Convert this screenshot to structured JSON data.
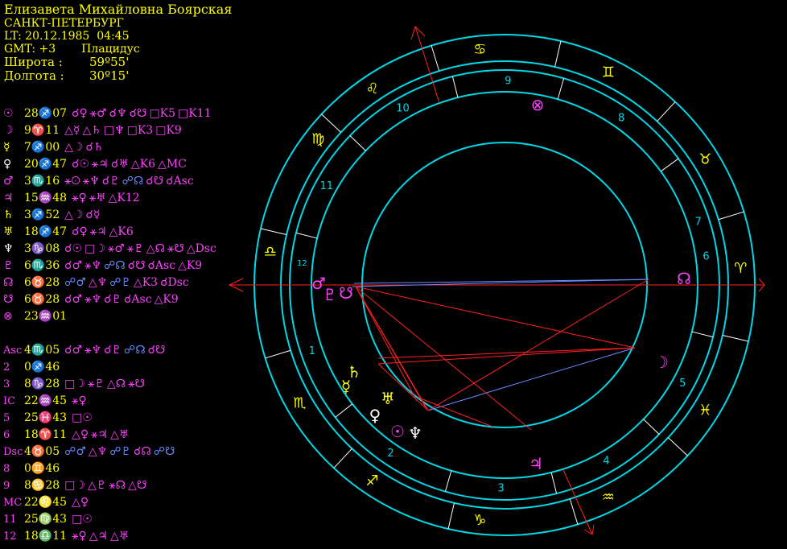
{
  "header": {
    "name": "Елизавета Михайловна Боярская",
    "city": "САНКТ-ПЕТЕРБУРГ",
    "local_time": "LT: 20.12.1985  04:45",
    "gmt": "GMT: +3",
    "house_system": "Плацидус",
    "latitude_label": "Широта :",
    "latitude_value": "59º55'",
    "longitude_label": "Долгота :",
    "longitude_value": "30º15'"
  },
  "colors": {
    "yellow": "#ffff00",
    "magenta": "#ff40ff",
    "cyan": "#00d8e8",
    "blue": "#6a8cff",
    "red": "#ff2020",
    "white": "#ffffff",
    "background": "#000000"
  },
  "planets": [
    {
      "glyph": "☉",
      "color": "#ff40ff",
      "pos": "28♐07",
      "aspects": [
        {
          "t": "☌♀",
          "c": "#ff40ff"
        },
        {
          "t": "⚹♂",
          "c": "#ff40ff"
        },
        {
          "t": "☌♆",
          "c": "#ff40ff"
        },
        {
          "t": "☌☋",
          "c": "#ff40ff"
        },
        {
          "t": "□K5",
          "c": "#ff40ff"
        },
        {
          "t": "□K11",
          "c": "#ff40ff"
        }
      ]
    },
    {
      "glyph": "☽",
      "color": "#ff40ff",
      "pos": "9♈11",
      "aspects": [
        {
          "t": "△☿",
          "c": "#ff40ff"
        },
        {
          "t": "△♄",
          "c": "#ff40ff"
        },
        {
          "t": "□♆",
          "c": "#ff40ff"
        },
        {
          "t": "□K3",
          "c": "#ff40ff"
        },
        {
          "t": "□K9",
          "c": "#ff40ff"
        }
      ]
    },
    {
      "glyph": "☿",
      "color": "#ffff00",
      "pos": "7♐00",
      "aspects": [
        {
          "t": "△☽",
          "c": "#ff40ff"
        },
        {
          "t": "☌♄",
          "c": "#ff40ff"
        }
      ]
    },
    {
      "glyph": "♀",
      "color": "#ffffff",
      "pos": "20♐47",
      "aspects": [
        {
          "t": "☌☉",
          "c": "#ff40ff"
        },
        {
          "t": "⚹♃",
          "c": "#ff40ff"
        },
        {
          "t": "☌♅",
          "c": "#ff40ff"
        },
        {
          "t": "△K6",
          "c": "#ff40ff"
        },
        {
          "t": "△MC",
          "c": "#ff40ff"
        }
      ]
    },
    {
      "glyph": "♂",
      "color": "#ff40ff",
      "pos": "3♏16",
      "aspects": [
        {
          "t": "⚹☉",
          "c": "#ff40ff"
        },
        {
          "t": "⚹♆",
          "c": "#ff40ff"
        },
        {
          "t": "☌♇",
          "c": "#ff40ff"
        },
        {
          "t": "☍☊",
          "c": "#6a8cff"
        },
        {
          "t": "☌☋",
          "c": "#ff40ff"
        },
        {
          "t": "☌Asc",
          "c": "#ff40ff"
        }
      ]
    },
    {
      "glyph": "♃",
      "color": "#ff40ff",
      "pos": "15♒48",
      "aspects": [
        {
          "t": "⚹♀",
          "c": "#ff40ff"
        },
        {
          "t": "⚹♅",
          "c": "#ff40ff"
        },
        {
          "t": "△K12",
          "c": "#ff40ff"
        }
      ]
    },
    {
      "glyph": "♄",
      "color": "#ffff00",
      "pos": "3♐52",
      "aspects": [
        {
          "t": "△☽",
          "c": "#ff40ff"
        },
        {
          "t": "☌☿",
          "c": "#ff40ff"
        }
      ]
    },
    {
      "glyph": "♅",
      "color": "#ffff00",
      "pos": "18♐47",
      "aspects": [
        {
          "t": "☌♀",
          "c": "#ff40ff"
        },
        {
          "t": "⚹♃",
          "c": "#ff40ff"
        },
        {
          "t": "△K6",
          "c": "#ff40ff"
        }
      ]
    },
    {
      "glyph": "♆",
      "color": "#ffffff",
      "pos": "3♑08",
      "aspects": [
        {
          "t": "☌☉",
          "c": "#ff40ff"
        },
        {
          "t": "□☽",
          "c": "#ff40ff"
        },
        {
          "t": "⚹♂",
          "c": "#ff40ff"
        },
        {
          "t": "⚹♇",
          "c": "#ff40ff"
        },
        {
          "t": "△☊",
          "c": "#ff40ff"
        },
        {
          "t": "⚹☋",
          "c": "#ff40ff"
        },
        {
          "t": "△Dsc",
          "c": "#ff40ff"
        }
      ]
    },
    {
      "glyph": "♇",
      "color": "#ff40ff",
      "pos": "6♏36",
      "aspects": [
        {
          "t": "☌♂",
          "c": "#ff40ff"
        },
        {
          "t": "⚹♆",
          "c": "#ff40ff"
        },
        {
          "t": "☍☊",
          "c": "#6a8cff"
        },
        {
          "t": "☌☋",
          "c": "#ff40ff"
        },
        {
          "t": "☌Asc",
          "c": "#ff40ff"
        },
        {
          "t": "△K9",
          "c": "#ff40ff"
        }
      ]
    },
    {
      "glyph": "☊",
      "color": "#ff40ff",
      "pos": "6♉28",
      "aspects": [
        {
          "t": "☍♂",
          "c": "#6a8cff"
        },
        {
          "t": "△♆",
          "c": "#ff40ff"
        },
        {
          "t": "☍♇",
          "c": "#6a8cff"
        },
        {
          "t": "△K3",
          "c": "#ff40ff"
        },
        {
          "t": "☌Dsc",
          "c": "#ff40ff"
        }
      ]
    },
    {
      "glyph": "☋",
      "color": "#ff40ff",
      "pos": "6♉28",
      "aspects": [
        {
          "t": "☌♂",
          "c": "#ff40ff"
        },
        {
          "t": "⚹♆",
          "c": "#ff40ff"
        },
        {
          "t": "☌♇",
          "c": "#ff40ff"
        },
        {
          "t": "☌Asc",
          "c": "#ff40ff"
        },
        {
          "t": "△K9",
          "c": "#ff40ff"
        }
      ]
    },
    {
      "glyph": "⊗",
      "color": "#ff40ff",
      "pos": "23♒01",
      "aspects": []
    }
  ],
  "houses": [
    {
      "label": "Asc",
      "pos": "4♏05",
      "aspects": [
        {
          "t": "☌♂",
          "c": "#ff40ff"
        },
        {
          "t": "⚹♆",
          "c": "#ff40ff"
        },
        {
          "t": "☌♇",
          "c": "#ff40ff"
        },
        {
          "t": "☍☊",
          "c": "#6a8cff"
        },
        {
          "t": "☌☋",
          "c": "#ff40ff"
        }
      ]
    },
    {
      "label": "2",
      "pos": "0♐46",
      "aspects": []
    },
    {
      "label": "3",
      "pos": "8♑28",
      "aspects": [
        {
          "t": "□☽",
          "c": "#ff40ff"
        },
        {
          "t": "⚹♇",
          "c": "#ff40ff"
        },
        {
          "t": "△☊",
          "c": "#ff40ff"
        },
        {
          "t": "⚹☋",
          "c": "#ff40ff"
        }
      ]
    },
    {
      "label": "IC",
      "pos": "22♒45",
      "aspects": [
        {
          "t": "⚹♀",
          "c": "#ff40ff"
        }
      ]
    },
    {
      "label": "5",
      "pos": "25♓43",
      "aspects": [
        {
          "t": "□☉",
          "c": "#ff40ff"
        }
      ]
    },
    {
      "label": "6",
      "pos": "18♈11",
      "aspects": [
        {
          "t": "△♀",
          "c": "#ff40ff"
        },
        {
          "t": "⚹♃",
          "c": "#ff40ff"
        },
        {
          "t": "△♅",
          "c": "#ff40ff"
        }
      ]
    },
    {
      "label": "Dsc",
      "pos": "4♉05",
      "aspects": [
        {
          "t": "☍♂",
          "c": "#6a8cff"
        },
        {
          "t": "△♆",
          "c": "#ff40ff"
        },
        {
          "t": "☍♇",
          "c": "#6a8cff"
        },
        {
          "t": "☌☊",
          "c": "#ff40ff"
        },
        {
          "t": "☍☋",
          "c": "#6a8cff"
        }
      ]
    },
    {
      "label": "8",
      "pos": "0♊46",
      "aspects": []
    },
    {
      "label": "9",
      "pos": "8♋28",
      "aspects": [
        {
          "t": "□☽",
          "c": "#ff40ff"
        },
        {
          "t": "△♇",
          "c": "#ff40ff"
        },
        {
          "t": "⚹☊",
          "c": "#ff40ff"
        },
        {
          "t": "△☋",
          "c": "#ff40ff"
        }
      ]
    },
    {
      "label": "MC",
      "pos": "22♌45",
      "aspects": [
        {
          "t": "△♀",
          "c": "#ff40ff"
        }
      ]
    },
    {
      "label": "11",
      "pos": "25♍43",
      "aspects": [
        {
          "t": "□☉",
          "c": "#ff40ff"
        }
      ]
    },
    {
      "label": "12",
      "pos": "18♎11",
      "aspects": [
        {
          "t": "⚹♀",
          "c": "#ff40ff"
        },
        {
          "t": "△♃",
          "c": "#ff40ff"
        },
        {
          "t": "△♅",
          "c": "#ff40ff"
        }
      ]
    }
  ],
  "wheel": {
    "signs": [
      {
        "glyph": "♋",
        "icon": "cancer-icon"
      },
      {
        "glyph": "♊",
        "icon": "gemini-icon"
      },
      {
        "glyph": "♉",
        "icon": "taurus-icon"
      },
      {
        "glyph": "♈",
        "icon": "aries-icon"
      },
      {
        "glyph": "♓",
        "icon": "pisces-icon"
      },
      {
        "glyph": "♒",
        "icon": "aquarius-icon"
      },
      {
        "glyph": "♑",
        "icon": "capricorn-icon"
      },
      {
        "glyph": "♐",
        "icon": "sagittarius-icon"
      },
      {
        "glyph": "♏",
        "icon": "scorpio-icon"
      },
      {
        "glyph": "♎",
        "icon": "libra-icon"
      },
      {
        "glyph": "♍",
        "icon": "virgo-icon"
      },
      {
        "glyph": "♌",
        "icon": "leo-icon"
      }
    ],
    "house_numbers": [
      "1",
      "2",
      "3",
      "4",
      "5",
      "6",
      "7",
      "8",
      "9",
      "10",
      "11",
      "12"
    ],
    "chart_planets": [
      {
        "glyph": "♂",
        "icon": "mars-icon",
        "color": "#ff40ff"
      },
      {
        "glyph": "♇",
        "icon": "pluto-icon",
        "color": "#ff40ff"
      },
      {
        "glyph": "☋",
        "icon": "south-node-icon",
        "color": "#ff40ff"
      },
      {
        "glyph": "☊",
        "icon": "north-node-icon",
        "color": "#ff40ff"
      },
      {
        "glyph": "☽",
        "icon": "moon-icon",
        "color": "#ff40ff"
      },
      {
        "glyph": "♄",
        "icon": "saturn-icon",
        "color": "#ffff00"
      },
      {
        "glyph": "☿",
        "icon": "mercury-icon",
        "color": "#ffff00"
      },
      {
        "glyph": "♅",
        "icon": "uranus-icon",
        "color": "#ffff00"
      },
      {
        "glyph": "♀",
        "icon": "venus-icon",
        "color": "#ffffff"
      },
      {
        "glyph": "☉",
        "icon": "sun-icon",
        "color": "#ff40ff"
      },
      {
        "glyph": "♆",
        "icon": "neptune-icon",
        "color": "#ffffff"
      },
      {
        "glyph": "♃",
        "icon": "jupiter-icon",
        "color": "#ff40ff"
      },
      {
        "glyph": "⊗",
        "icon": "part-of-fortune-icon",
        "color": "#ff40ff"
      }
    ]
  }
}
